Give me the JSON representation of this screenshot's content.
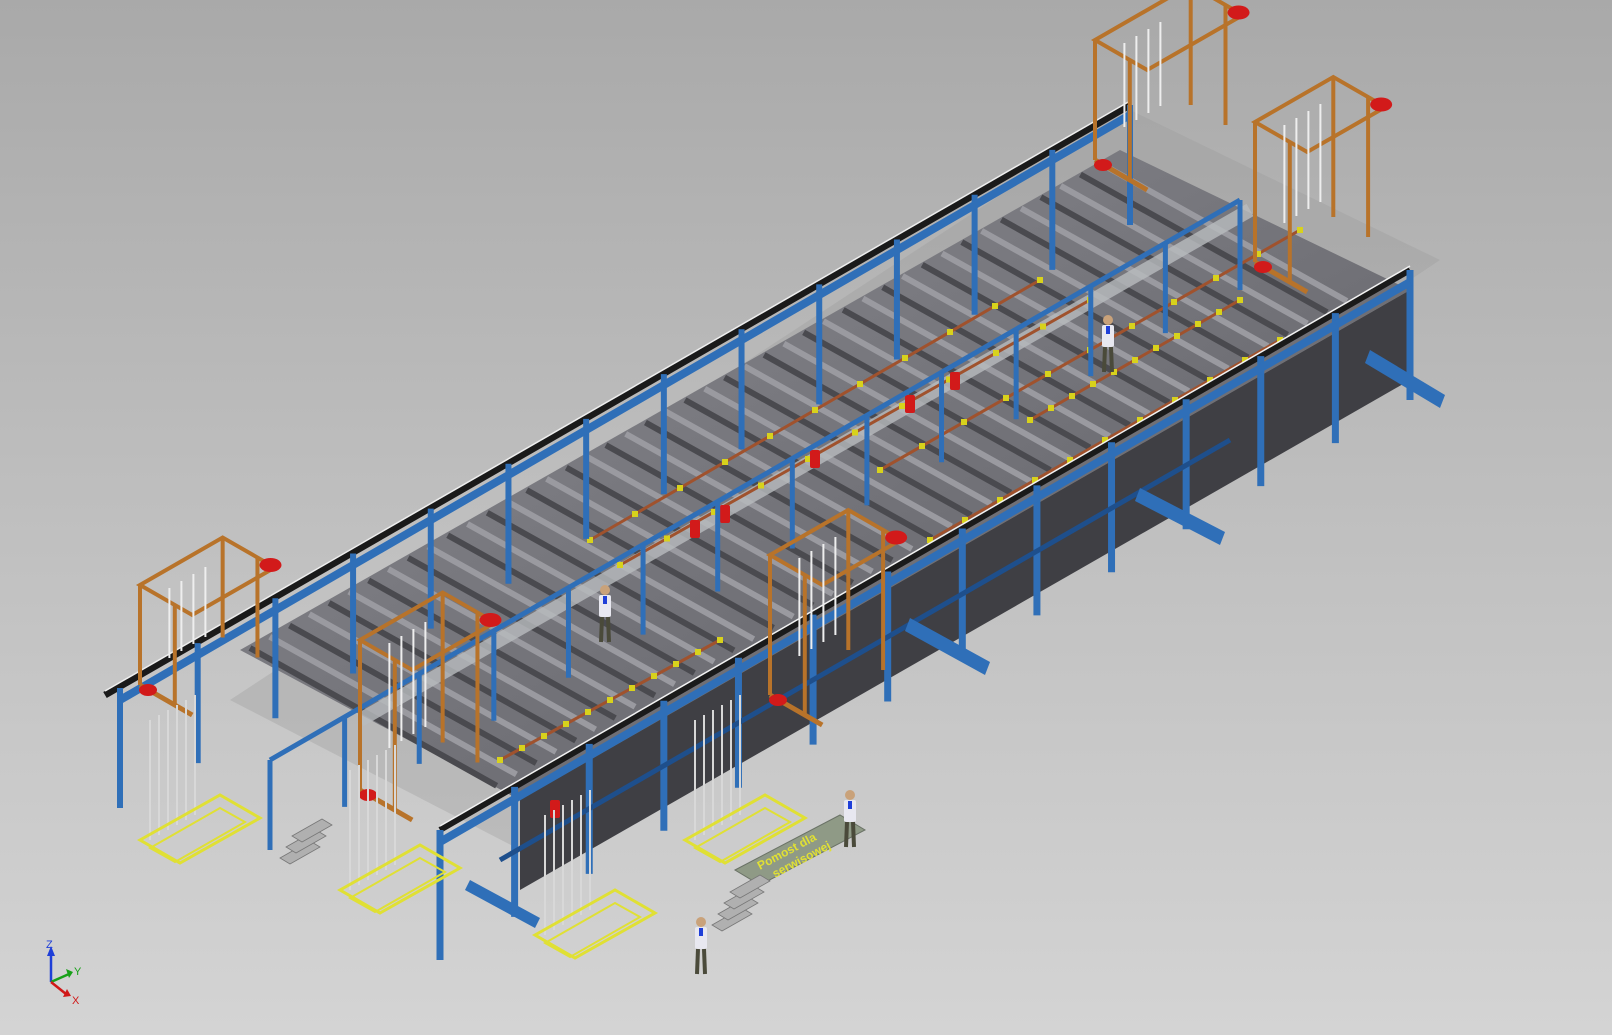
{
  "viewport": {
    "view_name": "isometric-view",
    "background_top": "#a9a9a9",
    "background_bottom": "#d4d4d4"
  },
  "scene": {
    "sign_line_1": "Pomost dla",
    "sign_line_2": "serwisowej",
    "colors": {
      "frame_blue": "#2f6fb8",
      "frame_blue_dark": "#1e4f8c",
      "gantry_orange": "#b8732a",
      "motor_red": "#d21a1a",
      "tank_dark": "#4a4a4f",
      "tank_mid": "#6a6a70",
      "tank_light": "#9a9aa0",
      "bus_copper": "#a0522d",
      "clamp_yellow": "#d8d21c",
      "rail_black": "#1a1a1a",
      "platform_yellow": "#e0e034"
    }
  },
  "triad": {
    "z_label": "Z",
    "y_label": "Y",
    "x_label": "X",
    "z_color": "#1f3fd8",
    "y_color": "#18a018",
    "x_color": "#d01818"
  }
}
